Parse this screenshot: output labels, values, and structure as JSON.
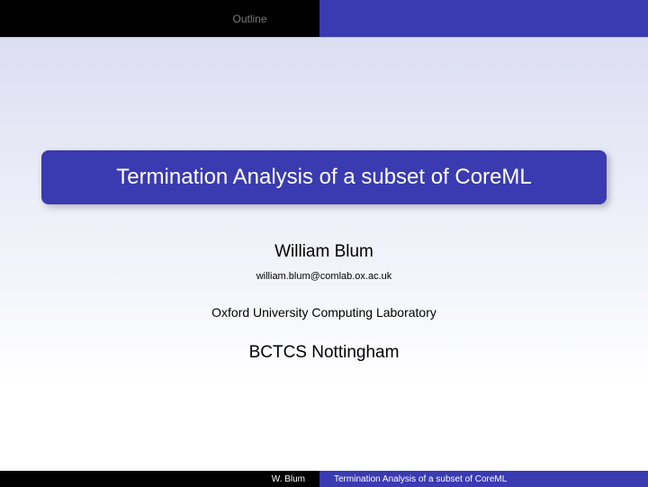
{
  "nav": {
    "outline": "Outline"
  },
  "slide": {
    "title": "Termination Analysis of a subset of CoreML",
    "author": "William Blum",
    "email": "william.blum@comlab.ox.ac.uk",
    "affiliation": "Oxford University Computing Laboratory",
    "venue": "BCTCS Nottingham"
  },
  "footer": {
    "author_short": "W. Blum",
    "title_short": "Termination Analysis of a subset of CoreML"
  }
}
